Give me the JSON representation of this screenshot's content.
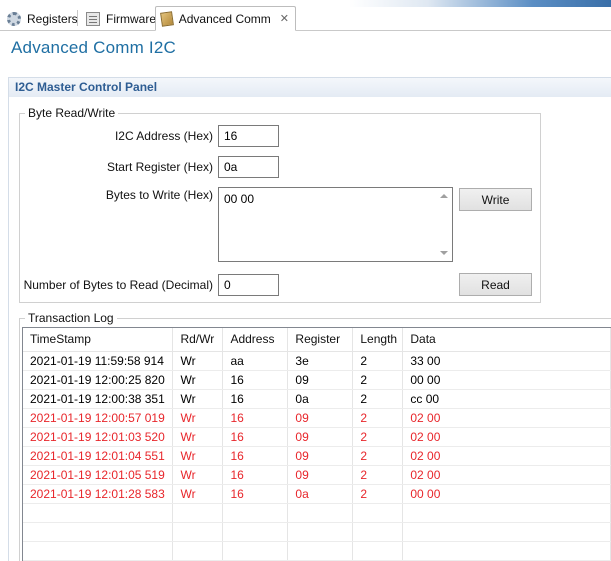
{
  "tabs": [
    {
      "label": "Registers",
      "icon": "gear-icon"
    },
    {
      "label": "Firmware",
      "icon": "firmware-icon"
    },
    {
      "label": "Advanced Comm",
      "icon": "package-icon",
      "active": true
    }
  ],
  "editor": {
    "title": "Advanced Comm I2C"
  },
  "section": {
    "title": "I2C Master Control Panel"
  },
  "byte_rw": {
    "legend": "Byte Read/Write",
    "i2c_address_label": "I2C Address (Hex)",
    "i2c_address_value": "16",
    "start_register_label": "Start Register (Hex)",
    "start_register_value": "0a",
    "bytes_to_write_label": "Bytes to Write (Hex)",
    "bytes_to_write_value": "00 00",
    "write_button": "Write",
    "bytes_to_read_label": "Number of Bytes to Read (Decimal)",
    "bytes_to_read_value": "0",
    "read_button": "Read"
  },
  "log": {
    "legend": "Transaction Log",
    "columns": [
      "TimeStamp",
      "Rd/Wr",
      "Address",
      "Register",
      "Length",
      "Data"
    ],
    "rows": [
      {
        "timestamp": "2021-01-19 11:59:58 914",
        "rdwr": "Wr",
        "address": "aa",
        "register": "3e",
        "length": "2",
        "data": "33 00",
        "error": false
      },
      {
        "timestamp": "2021-01-19 12:00:25 820",
        "rdwr": "Wr",
        "address": "16",
        "register": "09",
        "length": "2",
        "data": "00 00",
        "error": false
      },
      {
        "timestamp": "2021-01-19 12:00:38 351",
        "rdwr": "Wr",
        "address": "16",
        "register": "0a",
        "length": "2",
        "data": "cc 00",
        "error": false
      },
      {
        "timestamp": "2021-01-19 12:00:57 019",
        "rdwr": "Wr",
        "address": "16",
        "register": "09",
        "length": "2",
        "data": "02 00",
        "error": true
      },
      {
        "timestamp": "2021-01-19 12:01:03 520",
        "rdwr": "Wr",
        "address": "16",
        "register": "09",
        "length": "2",
        "data": "02 00",
        "error": true
      },
      {
        "timestamp": "2021-01-19 12:01:04 551",
        "rdwr": "Wr",
        "address": "16",
        "register": "09",
        "length": "2",
        "data": "02 00",
        "error": true
      },
      {
        "timestamp": "2021-01-19 12:01:05 519",
        "rdwr": "Wr",
        "address": "16",
        "register": "09",
        "length": "2",
        "data": "02 00",
        "error": true
      },
      {
        "timestamp": "2021-01-19 12:01:28 583",
        "rdwr": "Wr",
        "address": "16",
        "register": "0a",
        "length": "2",
        "data": "00 00",
        "error": true
      }
    ],
    "empty_rows": 3
  },
  "colors": {
    "title_blue": "#1f6fa3",
    "section_blue": "#2e5d93",
    "error_red": "#e8262b"
  }
}
